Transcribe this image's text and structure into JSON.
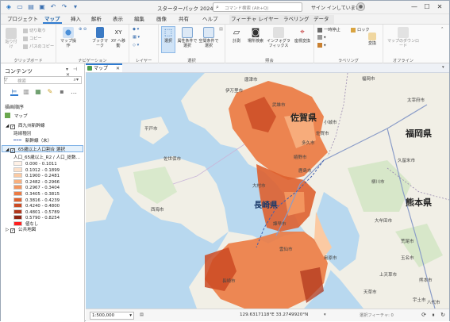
{
  "titlebar": {
    "title": "スターターパック 2024",
    "search_placeholder": "コマンド検索 (Alt+Q)",
    "signin": "サイン インしていません",
    "window_buttons": [
      "—",
      "☐",
      "✕"
    ]
  },
  "tabs": [
    "プロジェクト",
    "マップ",
    "挿入",
    "解析",
    "表示",
    "編集",
    "画像",
    "共有",
    "ヘルプ",
    "フィーチャ レイヤー",
    "ラベリング",
    "データ"
  ],
  "ribbon": {
    "clipboard": {
      "paste": "貼り付け",
      "cut": "切り取り",
      "copy": "コピー",
      "copy_path": "パスのコピー",
      "label": "クリップボード"
    },
    "navigation": {
      "explore": "マップ操作",
      "bookmarks": "ブックマーク",
      "xy": "XY へ移動",
      "label": "ナビゲーション"
    },
    "layer": {
      "label": "レイヤー"
    },
    "selection": {
      "select": "選択",
      "by_attr": "属性条件で選択",
      "by_loc": "空間条件で選択",
      "label": "選択"
    },
    "inquiry": {
      "measure": "計測",
      "locate": "場所検索",
      "infographics": "インフォグラフィックス",
      "coord": "座標変換",
      "label": "照会"
    },
    "labeling": {
      "pause": "一時停止",
      "lock": "ロック",
      "convert": "変換",
      "label": "ラベリング"
    },
    "offline": {
      "download": "マップのダウンロード",
      "label": "オフライン"
    }
  },
  "contents": {
    "title": "コンテンツ",
    "search_placeholder": "検索",
    "drawing_order": "描画順序",
    "map": "マップ",
    "layer1": "西九州新幹線",
    "layer1_sub": "路線種別",
    "layer1_legend": "新幹線（未）",
    "layer2": "65歳以上人口割合 選択",
    "layer2_field": "人口_65歳以上_R2 / 人口_総数...",
    "classes": [
      {
        "label": "0.000 - 0.1011",
        "color": "#fff1e6"
      },
      {
        "label": "0.1012 - 0.1899",
        "color": "#fde0c9"
      },
      {
        "label": "0.1900 - 0.2481",
        "color": "#fbcaa3"
      },
      {
        "label": "0.2482 - 0.2966",
        "color": "#f8b07f"
      },
      {
        "label": "0.2967 - 0.3404",
        "color": "#f3955e"
      },
      {
        "label": "0.3405 - 0.3815",
        "color": "#ec7b43"
      },
      {
        "label": "0.3816 - 0.4239",
        "color": "#de612f"
      },
      {
        "label": "0.4240 - 0.4800",
        "color": "#cb4a23"
      },
      {
        "label": "0.4801 - 0.5789",
        "color": "#b0371c"
      },
      {
        "label": "0.5790 - 0.8254",
        "color": "#8f2614"
      },
      {
        "label": "値なし",
        "color": "#ff2020"
      }
    ],
    "basemap": "公共地図"
  },
  "map_tab": {
    "label": "マップ"
  },
  "map_labels": {
    "places": [
      "福岡市",
      "太宰府市",
      "佐賀市",
      "唐津市",
      "伊万里市",
      "武雄市",
      "嬉野市",
      "鹿島市",
      "諫早市",
      "島原市",
      "雲仙市",
      "大村市",
      "佐世保市",
      "西海市",
      "長崎市",
      "久留米市",
      "柳川市",
      "大牟田市",
      "荒尾市",
      "玉名市",
      "熊本市",
      "平戸市",
      "小城市",
      "多久市",
      "宇土市",
      "天草市",
      "上天草市",
      "八代市"
    ],
    "prefs": [
      "佐賀県",
      "福岡県",
      "長崎県",
      "熊本県"
    ]
  },
  "status": {
    "scale": "1:500,000",
    "coords": "129.6317118°E 33.2749920°N",
    "selected_features": "選択フィーチャ: 0"
  },
  "colors": {
    "accent": "#2f7bd1",
    "choropleth_mid": "#ec7b43",
    "water": "#b8d8ef",
    "land": "#f1efe6"
  }
}
